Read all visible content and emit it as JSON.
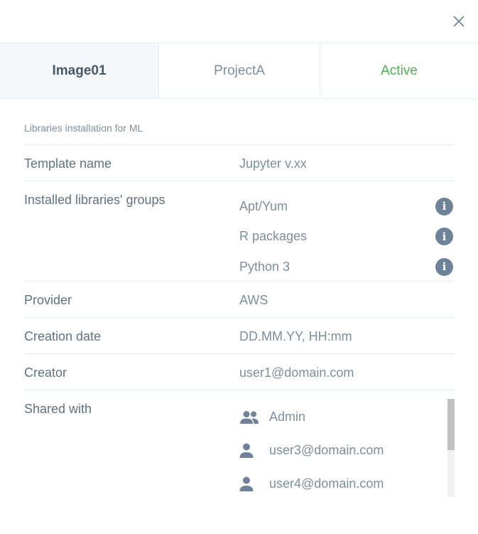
{
  "header": {
    "image_name": "Image01",
    "project": "ProjectA",
    "status": "Active"
  },
  "description": "Libraries installation for ML",
  "fields": {
    "template_name": {
      "label": "Template name",
      "value": "Jupyter v.xx"
    },
    "libraries": {
      "label": "Installed libraries' groups",
      "groups": [
        "Apt/Yum",
        "R packages",
        "Python 3"
      ]
    },
    "provider": {
      "label": "Provider",
      "value": "AWS"
    },
    "creation_date": {
      "label": "Creation date",
      "value": "DD.MM.YY, HH:mm"
    },
    "creator": {
      "label": "Creator",
      "value": "user1@domain.com"
    },
    "shared_with": {
      "label": "Shared with",
      "entries": [
        {
          "name": "Admin",
          "icon": "group-icon"
        },
        {
          "name": "user3@domain.com",
          "icon": "user-icon"
        },
        {
          "name": "user4@domain.com",
          "icon": "user-icon"
        }
      ]
    }
  },
  "colors": {
    "status_active": "#4caf50",
    "header_selected_bg": "#f5f8fb",
    "info_icon_bg": "#6e8399"
  }
}
